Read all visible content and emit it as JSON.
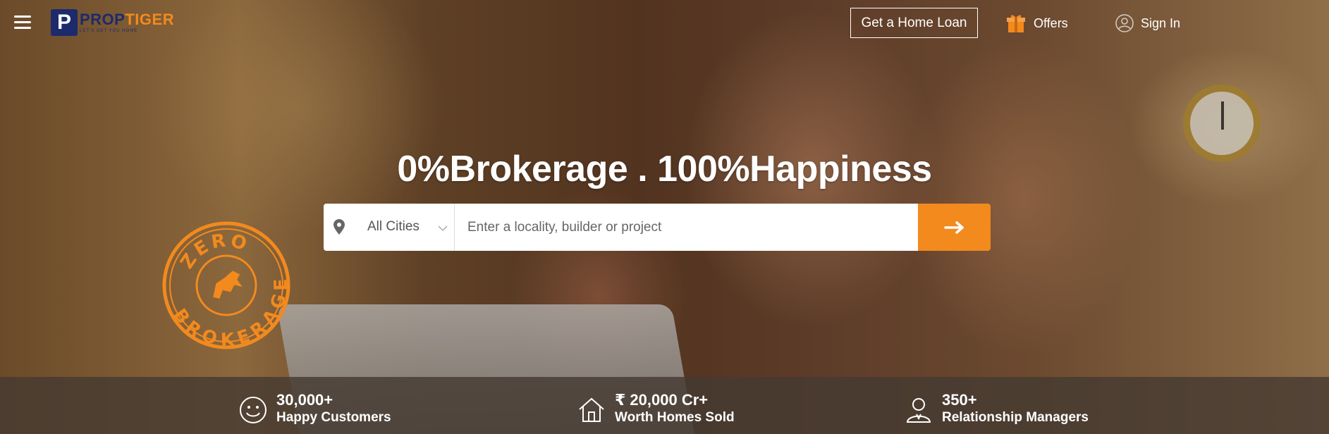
{
  "header": {
    "logo": {
      "name_part1": "PROP",
      "name_part2": "TIGER",
      "tagline": "LET'S GET YOU HOME",
      "mark": "P"
    },
    "loan_button": "Get a Home Loan",
    "offers_label": "Offers",
    "signin_label": "Sign In"
  },
  "hero": {
    "headline": "0%Brokerage . 100%Happiness",
    "stamp_text_top": "ZERO",
    "stamp_text_bottom": "BROKERAGE"
  },
  "search": {
    "city_selected": "All Cities",
    "placeholder": "Enter a locality, builder or project",
    "value": ""
  },
  "stats": [
    {
      "icon": "smiley-icon",
      "value": "30,000+",
      "label": "Happy Customers"
    },
    {
      "icon": "house-icon",
      "value": "₹ 20,000 Cr+",
      "label": "Worth Homes Sold"
    },
    {
      "icon": "agent-icon",
      "value": "350+",
      "label": "Relationship Managers"
    }
  ],
  "colors": {
    "accent": "#f28a1e",
    "brand_navy": "#1d2a6b",
    "stats_bar": "#463a32"
  }
}
